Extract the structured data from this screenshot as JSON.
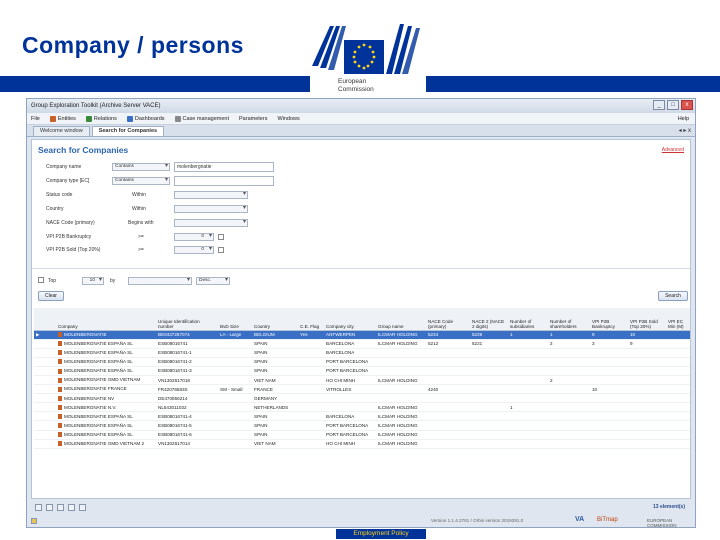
{
  "slide": {
    "title": "Company / persons",
    "logo_text_1": "European",
    "logo_text_2": "Commission",
    "footer_label": "Employment Policy"
  },
  "window": {
    "title": "Group Exploration Toolkit (Archive Server VACE)",
    "controls": [
      "_",
      "□",
      "x"
    ]
  },
  "menu": {
    "items": [
      "File",
      "Entities",
      "Relations",
      "Dashboards",
      "Case management",
      "Parameters",
      "Windows"
    ],
    "help": "Help"
  },
  "tabs": {
    "items": [
      "Welcome window",
      "Search for Companies"
    ],
    "active_index": 1,
    "controls": "◂ ▸ x"
  },
  "search": {
    "title": "Search for Companies",
    "advanced": "Advanced",
    "company_name_label": "Company name",
    "company_name_op": "Contains",
    "company_name_value": "molenbergnatie",
    "company_type_label": "Company type [EC]",
    "company_type_value": "Contains",
    "status_label": "Status code",
    "status_op": "Within",
    "country_label": "Country",
    "country_op": "Within",
    "nace_label": "NACE Code (primary)",
    "nace_op": "Begins with",
    "vpi_bank_label": "VPI P2B Bankruptcy",
    "vpi_bank_op": ">=",
    "vpi_bank_val": "0",
    "vpi_sold_label": "VPI P2B Sold (Top 20%)",
    "vpi_sold_op": ">=",
    "vpi_sold_val": "0",
    "top_label": "Top",
    "top_value": "10",
    "by_label": "by",
    "order_value": "Desc.",
    "clear_btn": "Clear",
    "search_btn": "Search"
  },
  "table": {
    "columns": [
      "",
      "Company",
      "Unique Identification number",
      "BvD Size",
      "Country",
      "C.E. Flag",
      "Company city",
      "Group name",
      "NACE Code (primary)",
      "NACE 2 (NACE 2 digits)",
      "Number of subsidiaries",
      "Number of shareholders",
      "VPI P2B Bankruptcy",
      "VPI P2B Sold (Top 20%)",
      "VPI EC Min (M)"
    ],
    "rows": [
      [
        "▶",
        "MOLENBERGNATIE",
        "BE0437287074",
        "LA - Large",
        "BELGIUM",
        "Yes",
        "ANTWERPEN",
        "ILCMAR HOLDING",
        "5224",
        "5229",
        "1",
        "1",
        "9",
        "10",
        ""
      ],
      [
        "",
        "MOLENBERGNATIE ESPAÑA SL",
        "ESB08016741",
        "",
        "SPAIN",
        "",
        "BARCELONA",
        "ILCMAR HOLDING",
        "5212",
        "5221",
        "",
        "2",
        "3",
        "9",
        ""
      ],
      [
        "",
        "MOLENBERGNATIE ESPAÑA SL",
        "ESB08016741-1",
        "",
        "SPAIN",
        "",
        "BARCELONA",
        "",
        "",
        "",
        "",
        "",
        "",
        "",
        ""
      ],
      [
        "",
        "MOLENBERGNATIE ESPAÑA SL",
        "ESB08016741-2",
        "",
        "SPAIN",
        "",
        "PORT BARCELONA",
        "",
        "",
        "",
        "",
        "",
        "",
        "",
        ""
      ],
      [
        "",
        "MOLENBERGNATIE ESPAÑA SL",
        "ESB08016741-3",
        "",
        "SPAIN",
        "",
        "PORT BARCELONA",
        "",
        "",
        "",
        "",
        "",
        "",
        "",
        ""
      ],
      [
        "",
        "MOLENBERGNATIE GMD VIETNAM",
        "VN1302617018",
        "",
        "VIET NAM",
        "",
        "HO CHI MINH",
        "ILCMAR HOLDING",
        "",
        "",
        "",
        "2",
        "",
        "",
        ""
      ],
      [
        "",
        "MOLENBERGNATIE FRANCE",
        "FR42076583S",
        "SM - Small",
        "FRANCE",
        "",
        "VITROLLES",
        "",
        "4240",
        "",
        "",
        "",
        "10",
        "",
        ""
      ],
      [
        "",
        "MOLENBERGNATIE NV",
        "DE470856214",
        "",
        "GERMANY",
        "",
        "",
        "",
        "",
        "",
        "",
        "",
        "",
        "",
        ""
      ],
      [
        "",
        "MOLENBERGNATIE N.V.",
        "NL543011032",
        "",
        "NETHERLANDS",
        "",
        "",
        "ILCMAR HOLDING",
        "",
        "",
        "1",
        "",
        "",
        "",
        ""
      ],
      [
        "",
        "MOLENBERGNATIE ESPAÑA SL",
        "ESB08016741-4",
        "",
        "SPAIN",
        "",
        "BARCELONA",
        "ILCMAR HOLDING",
        "",
        "",
        "",
        "",
        "",
        "",
        ""
      ],
      [
        "",
        "MOLENBERGNATIE ESPAÑA SL",
        "ESB08016741-5",
        "",
        "SPAIN",
        "",
        "PORT BARCELONA",
        "ILCMAR HOLDING",
        "",
        "",
        "",
        "",
        "",
        "",
        ""
      ],
      [
        "",
        "MOLENBERGNATIE ESPAÑA SL",
        "ESB08016741-6",
        "",
        "SPAIN",
        "",
        "PORT BARCELONA",
        "ILCMAR HOLDING",
        "",
        "",
        "",
        "",
        "",
        "",
        ""
      ],
      [
        "",
        "MOLENBERGNATIE GMD VIETNAM 2",
        "VN1302617014",
        "",
        "VIET NAM",
        "",
        "HO CHI MINH",
        "ILCMAR HOLDING",
        "",
        "",
        "",
        "",
        "",
        "",
        ""
      ]
    ]
  },
  "status": {
    "elements": "13 element(s)",
    "version": "Version 1.1.4.2781 / Orbis version 2019291.0",
    "brand1": "VA",
    "brand2": "BiTmap",
    "brand3": "EUROPEAN COMMISSION"
  },
  "colors": {
    "ec_blue": "#003399",
    "ec_yellow": "#ffd617",
    "selection": "#3a6fc6",
    "panel_title": "#2e65b3"
  }
}
